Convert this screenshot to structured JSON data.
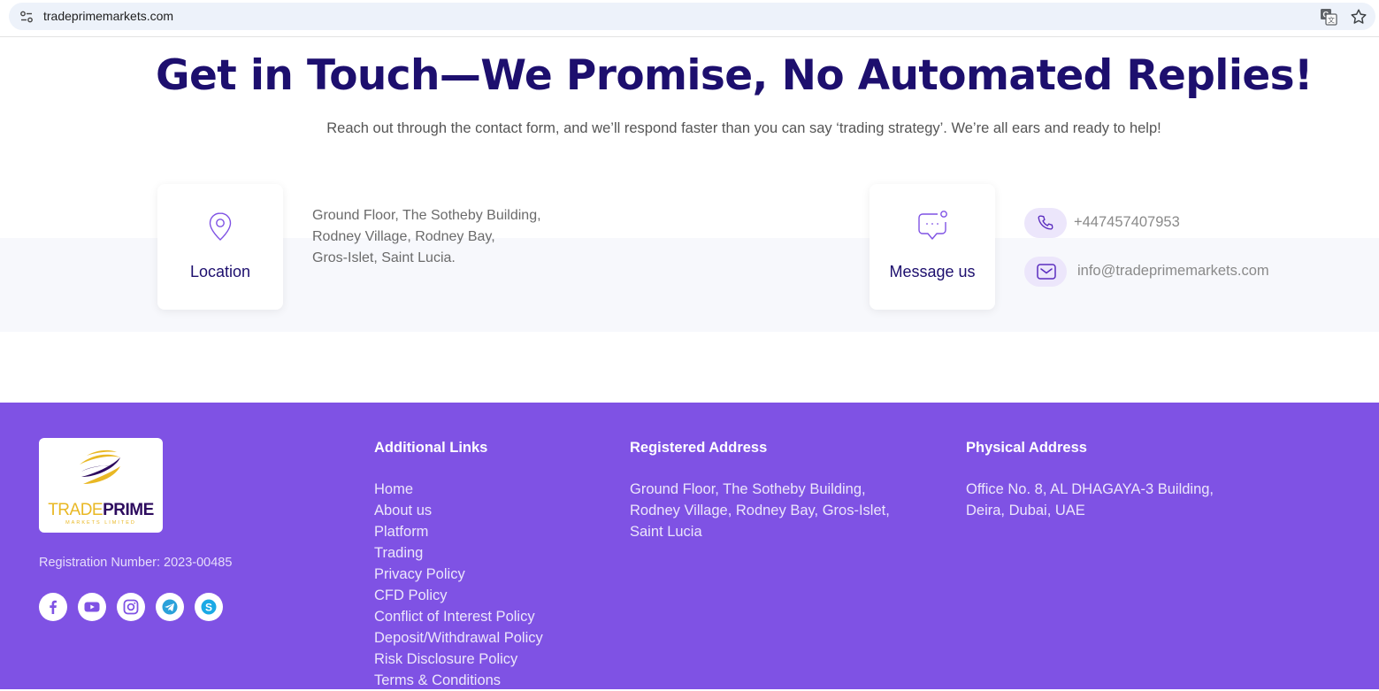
{
  "browser": {
    "url": "tradeprimemarkets.com",
    "icons": [
      "site-settings-icon",
      "translate-icon",
      "bookmark-star-icon"
    ]
  },
  "hero": {
    "title": "Get in Touch—We Promise, No Automated Replies!",
    "subtitle": "Reach out through the contact form, and we’ll respond faster than you can say ‘trading strategy’. We’re all ears and ready to help!"
  },
  "contact": {
    "location_card": {
      "label": "Location",
      "icon": "map-pin-icon"
    },
    "address": [
      "Ground Floor, The Sotheby Building,",
      "Rodney Village, Rodney Bay,",
      "Gros-Islet, Saint Lucia."
    ],
    "message_card": {
      "label": "Message us",
      "icon": "chat-bubble-icon"
    },
    "phone": "+447457407953",
    "email": "info@tradeprimemarkets.com"
  },
  "footer": {
    "logo": {
      "word1": "TRADE",
      "word2": "PRIME",
      "tagline": "MARKETS LIMITED"
    },
    "registration": "Registration Number: 2023-00485",
    "social": [
      "facebook-icon",
      "youtube-icon",
      "instagram-icon",
      "telegram-icon",
      "skype-icon"
    ],
    "colors": {
      "background": "#7f52e4",
      "heading": "#1d0f6e",
      "accent_gold": "#e9b824"
    },
    "links_heading": "Additional Links",
    "links": [
      "Home",
      "About us",
      "Platform",
      "Trading",
      "Privacy Policy",
      "CFD Policy",
      "Conflict of Interest Policy",
      "Deposit/Withdrawal Policy",
      "Risk Disclosure Policy",
      "Terms & Conditions"
    ],
    "registered_heading": "Registered Address",
    "registered_address": "Ground Floor, The Sotheby Building, Rodney Village, Rodney Bay, Gros-Islet, Saint Lucia",
    "physical_heading": "Physical Address",
    "physical_address": "Office No. 8, AL DHAGAYA-3 Building, Deira, Dubai, UAE"
  }
}
